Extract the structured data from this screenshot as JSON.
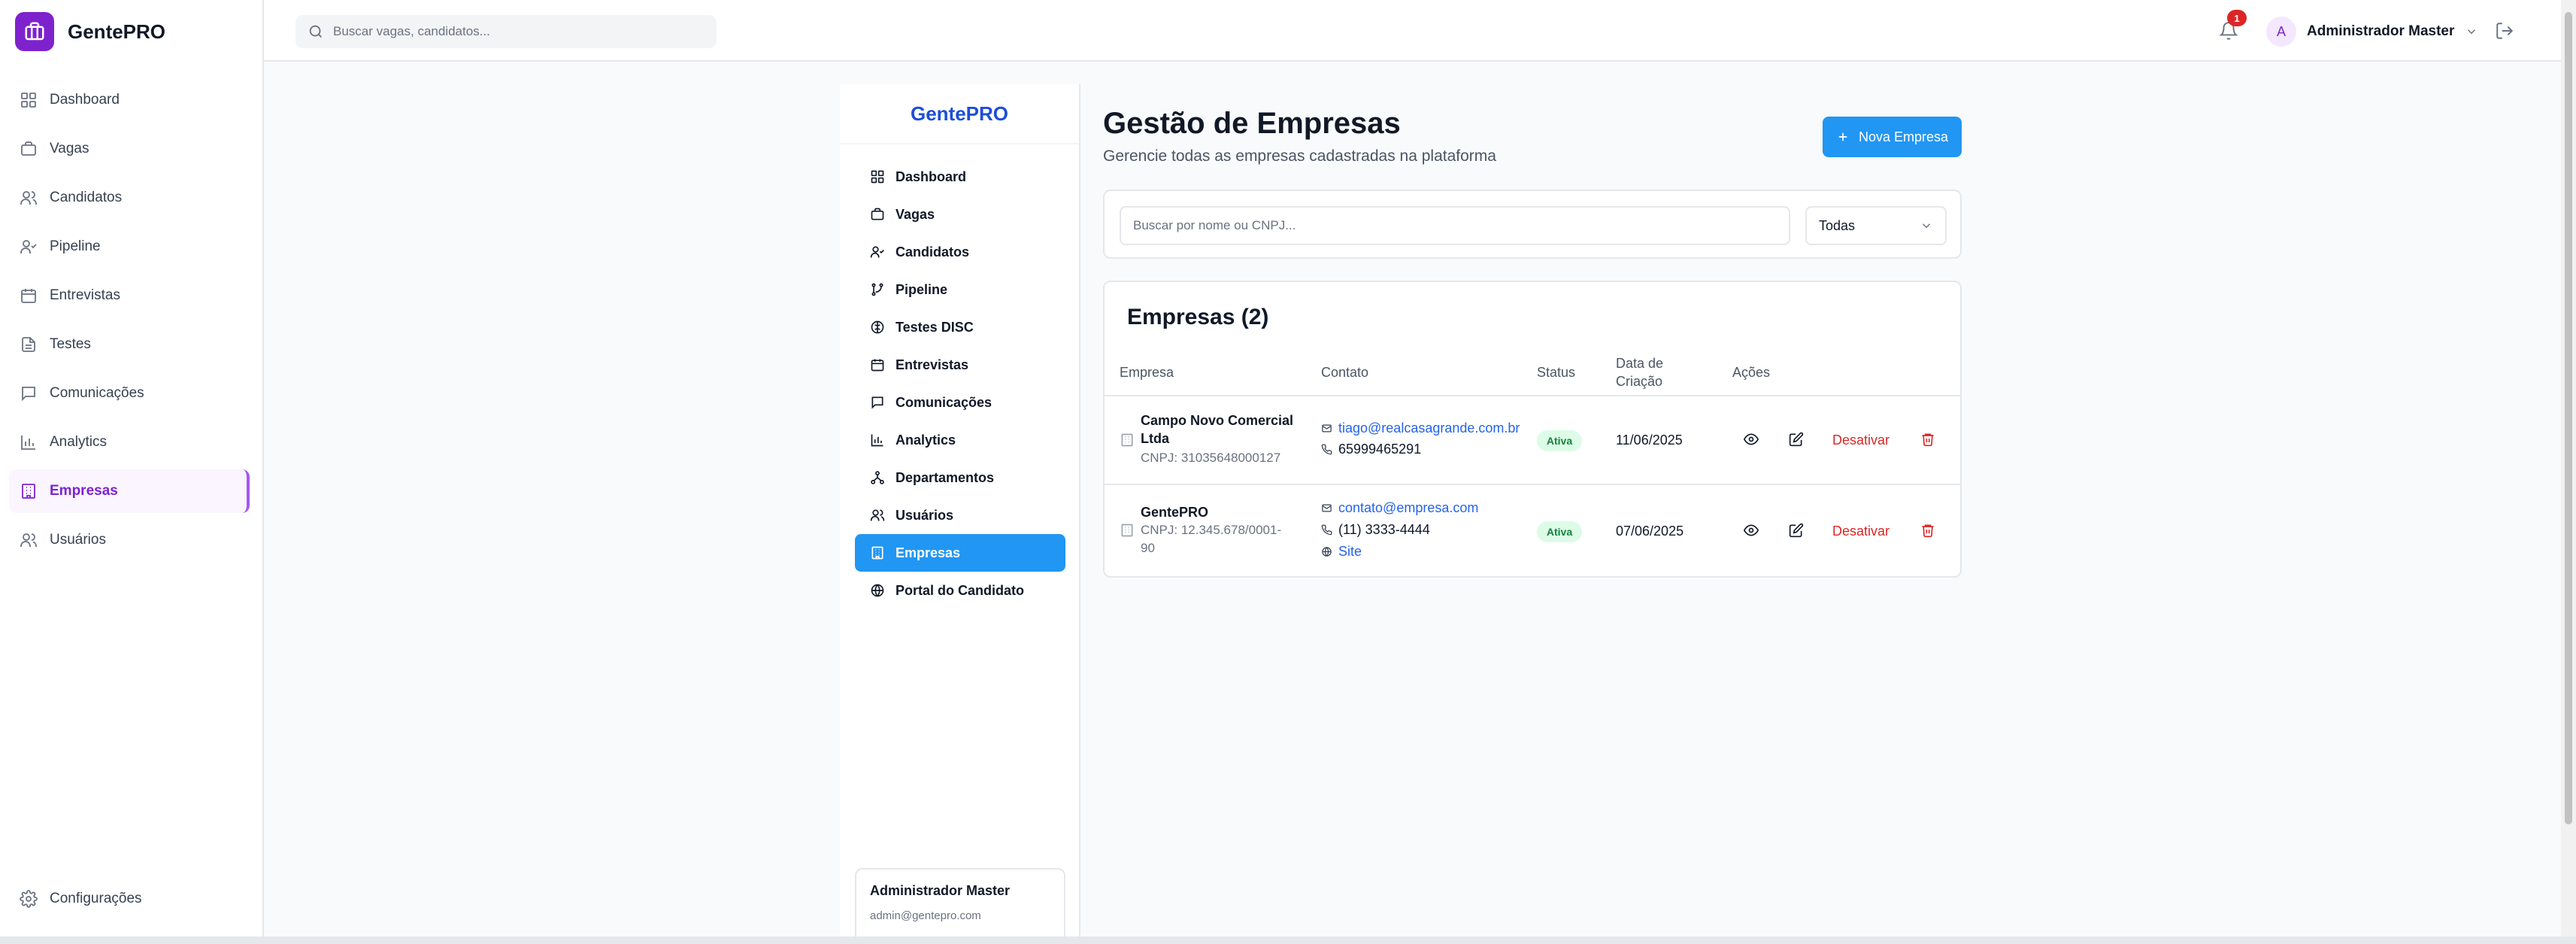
{
  "brand": {
    "name": "GentePRO"
  },
  "sidebar": {
    "items": [
      {
        "label": "Dashboard",
        "icon": "dashboard-icon"
      },
      {
        "label": "Vagas",
        "icon": "briefcase-icon"
      },
      {
        "label": "Candidatos",
        "icon": "users-icon"
      },
      {
        "label": "Pipeline",
        "icon": "user-check-icon"
      },
      {
        "label": "Entrevistas",
        "icon": "calendar-icon"
      },
      {
        "label": "Testes",
        "icon": "file-text-icon"
      },
      {
        "label": "Comunicações",
        "icon": "message-icon"
      },
      {
        "label": "Analytics",
        "icon": "bar-chart-icon"
      },
      {
        "label": "Empresas",
        "icon": "building-icon",
        "active": true
      },
      {
        "label": "Usuários",
        "icon": "users-icon"
      }
    ],
    "settings_label": "Configurações"
  },
  "header": {
    "search_placeholder": "Buscar vagas, candidatos...",
    "notification_count": "1",
    "user_initial": "A",
    "user_name": "Administrador Master"
  },
  "inner_sidebar": {
    "brand": "GentePRO",
    "items": [
      {
        "label": "Dashboard",
        "icon": "dashboard-icon"
      },
      {
        "label": "Vagas",
        "icon": "briefcase-icon"
      },
      {
        "label": "Candidatos",
        "icon": "user-check-icon"
      },
      {
        "label": "Pipeline",
        "icon": "git-branch-icon"
      },
      {
        "label": "Testes DISC",
        "icon": "disc-icon"
      },
      {
        "label": "Entrevistas",
        "icon": "calendar-icon"
      },
      {
        "label": "Comunicações",
        "icon": "message-icon"
      },
      {
        "label": "Analytics",
        "icon": "bar-chart-icon"
      },
      {
        "label": "Departamentos",
        "icon": "network-icon"
      },
      {
        "label": "Usuários",
        "icon": "users-icon"
      },
      {
        "label": "Empresas",
        "icon": "building-icon",
        "active": true
      },
      {
        "label": "Portal do Candidato",
        "icon": "globe-icon"
      }
    ],
    "user_name": "Administrador Master",
    "user_email": "admin@gentepro.com"
  },
  "page": {
    "title": "Gestão de Empresas",
    "subtitle": "Gerencie todas as empresas cadastradas na plataforma",
    "new_button_label": "Nova Empresa"
  },
  "filters": {
    "search_placeholder": "Buscar por nome ou CNPJ...",
    "status_selected": "Todas"
  },
  "table": {
    "title": "Empresas (2)",
    "headers": {
      "company": "Empresa",
      "contact": "Contato",
      "status": "Status",
      "created_line1": "Data de",
      "created_line2": "Criação",
      "actions": "Ações"
    },
    "rows": [
      {
        "name_line1": "Campo Novo Comercial",
        "name_line2": "Ltda",
        "cnpj_line1": "CNPJ: 31035648000127",
        "cnpj_line2": "",
        "email": "tiago@realcasagrande.com.br",
        "phone": "65999465291",
        "site": "",
        "status": "Ativa",
        "created": "11/06/2025",
        "deactivate_label": "Desativar"
      },
      {
        "name_line1": "GentePRO",
        "name_line2": "",
        "cnpj_line1": "CNPJ: 12.345.678/0001-",
        "cnpj_line2": "90",
        "email": "contato@empresa.com",
        "phone": "(11) 3333-4444",
        "site": "Site",
        "status": "Ativa",
        "created": "07/06/2025",
        "deactivate_label": "Desativar"
      }
    ]
  },
  "colors": {
    "brand_purple": "#7e22ce",
    "primary_blue": "#2196f3",
    "danger_red": "#dc2626",
    "success_green": "#15803d"
  }
}
